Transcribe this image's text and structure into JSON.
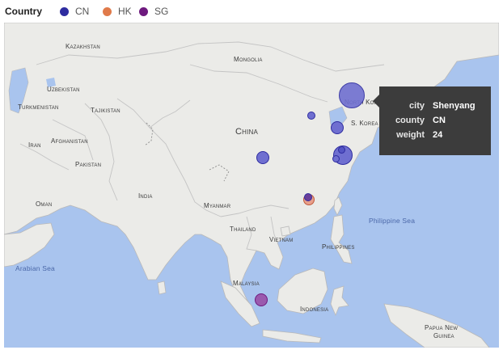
{
  "legend": {
    "title": "Country",
    "items": [
      {
        "label": "CN",
        "color": "#2e2ca0"
      },
      {
        "label": "HK",
        "color": "#e07a4a"
      },
      {
        "label": "SG",
        "color": "#6e1a7e"
      }
    ]
  },
  "map": {
    "labels": {
      "kazakhstan": "Kazakhstan",
      "mongolia": "Mongolia",
      "uzbekistan": "Uzbekistan",
      "turkmenistan": "Turkmenistan",
      "tajikistan": "Tajikistan",
      "afghanistan": "Afghanistan",
      "iran": "Iran",
      "pakistan": "Pakistan",
      "china": "China",
      "north_korea": "North Korea",
      "s_korea": "S. Korea",
      "india": "India",
      "oman": "Oman",
      "myanmar": "Myanmar",
      "thailand": "Thailand",
      "vietnam": "Vietnam",
      "philippines": "Philippines",
      "malaysia": "Malaysia",
      "indonesia": "Indonesia",
      "papua_new_guinea_1": "Papua New",
      "papua_new_guinea_2": "Guinea",
      "philippine_sea": "Philippine Sea",
      "arabian_sea": "Arabian Sea"
    }
  },
  "tooltip": {
    "rows": [
      {
        "key": "city",
        "value": "Shenyang"
      },
      {
        "key": "county",
        "value": "CN"
      },
      {
        "key": "weight",
        "value": "24"
      }
    ]
  },
  "colors": {
    "cn_fill": "#6f6fd0",
    "hk_fill": "#e8a08c",
    "sg_fill": "#9a5aae",
    "land": "#ebebe8",
    "water": "#a9c4ee"
  }
}
